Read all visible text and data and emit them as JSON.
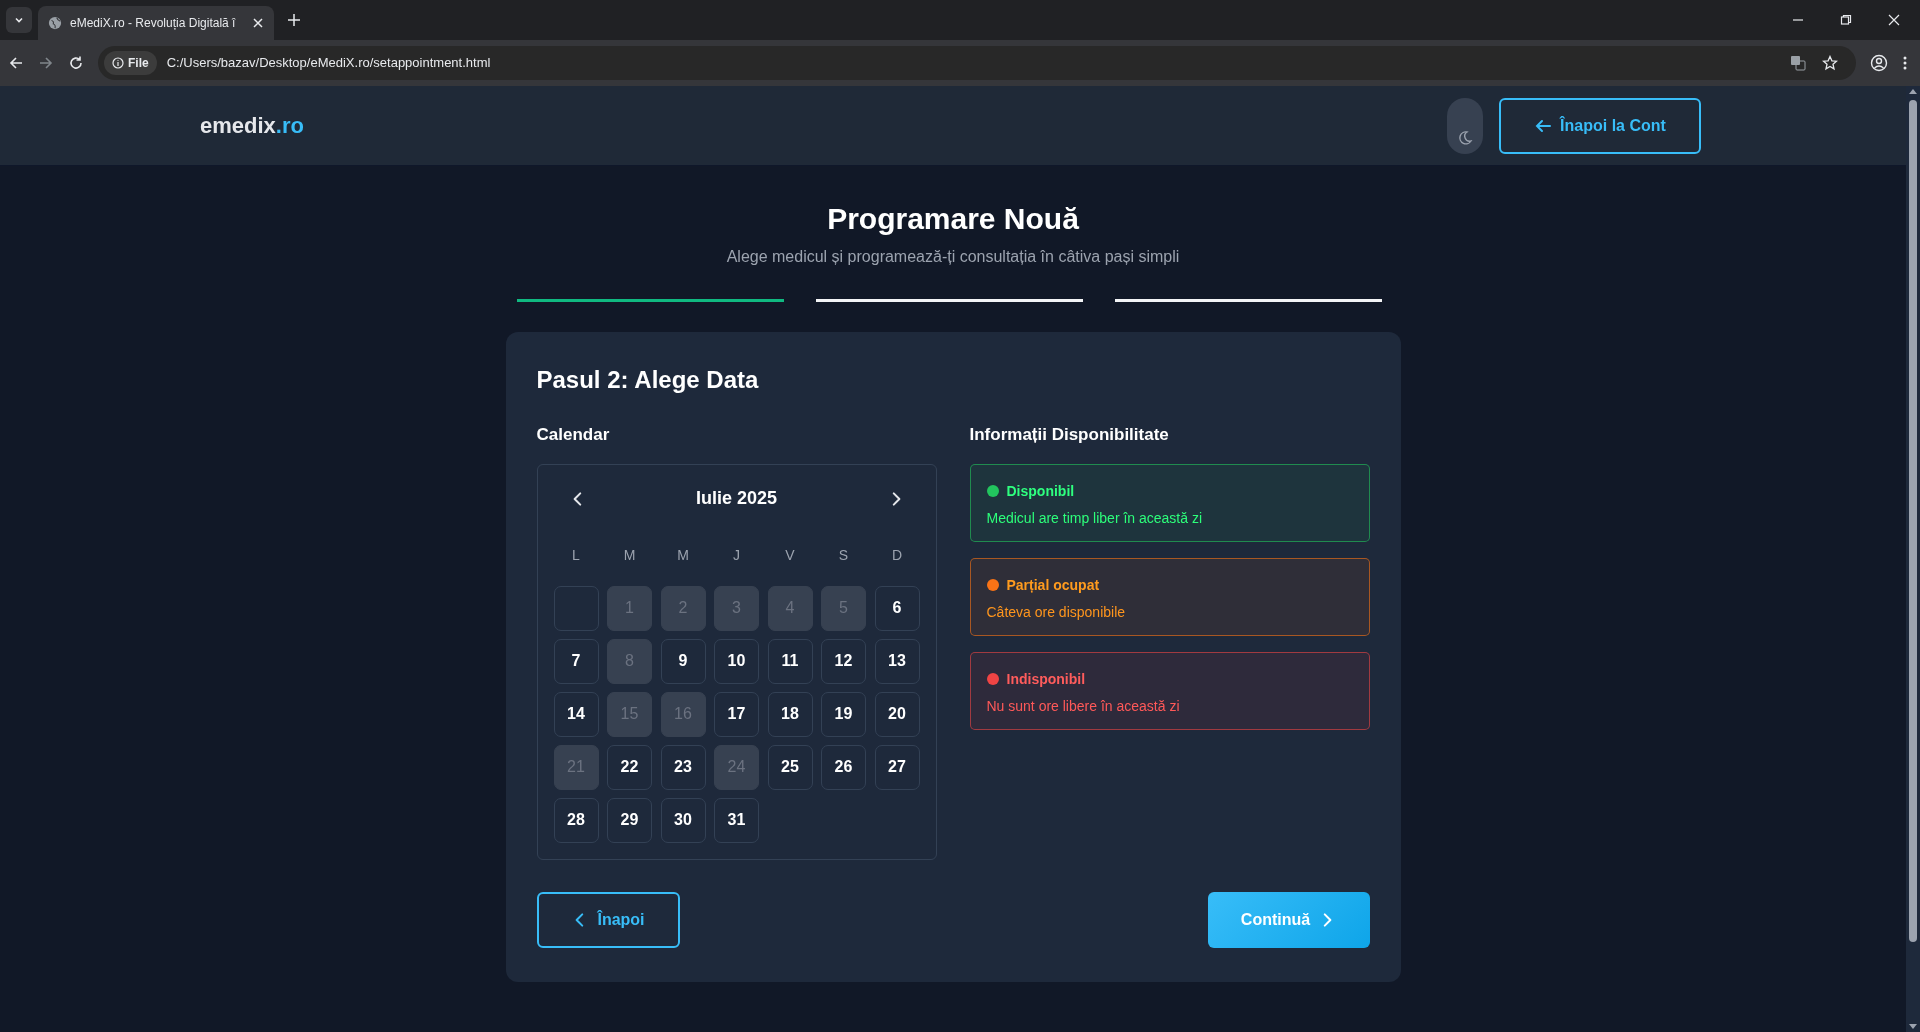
{
  "browser": {
    "tab_title": "eMediX.ro - Revoluția Digitală î",
    "address_badge": "File",
    "url": "C:/Users/bazav/Desktop/eMediX.ro/setappointment.html"
  },
  "header": {
    "logo_main": "emedix",
    "logo_accent": ".ro",
    "back_button": "Înapoi la Cont"
  },
  "page": {
    "title": "Programare Nouă",
    "subtitle": "Alege medicul și programează-ți consultația în câtiva pași simpli"
  },
  "steps": [
    {
      "completed": true
    },
    {
      "completed": false
    },
    {
      "completed": false
    }
  ],
  "step_card": {
    "title": "Pasul 2: Alege Data",
    "calendar_heading": "Calendar",
    "info_heading": "Informații Disponibilitate"
  },
  "calendar": {
    "month": "Iulie 2025",
    "weekdays": [
      "L",
      "M",
      "M",
      "J",
      "V",
      "S",
      "D"
    ],
    "days": [
      {
        "kind": "empty"
      },
      {
        "kind": "day",
        "label": "1",
        "disabled": true
      },
      {
        "kind": "day",
        "label": "2",
        "disabled": true
      },
      {
        "kind": "day",
        "label": "3",
        "disabled": true
      },
      {
        "kind": "day",
        "label": "4",
        "disabled": true
      },
      {
        "kind": "day",
        "label": "5",
        "disabled": true
      },
      {
        "kind": "day",
        "label": "6",
        "disabled": false
      },
      {
        "kind": "day",
        "label": "7",
        "disabled": false
      },
      {
        "kind": "day",
        "label": "8",
        "disabled": true
      },
      {
        "kind": "day",
        "label": "9",
        "disabled": false
      },
      {
        "kind": "day",
        "label": "10",
        "disabled": false
      },
      {
        "kind": "day",
        "label": "11",
        "disabled": false
      },
      {
        "kind": "day",
        "label": "12",
        "disabled": false
      },
      {
        "kind": "day",
        "label": "13",
        "disabled": false
      },
      {
        "kind": "day",
        "label": "14",
        "disabled": false
      },
      {
        "kind": "day",
        "label": "15",
        "disabled": true
      },
      {
        "kind": "day",
        "label": "16",
        "disabled": true
      },
      {
        "kind": "day",
        "label": "17",
        "disabled": false
      },
      {
        "kind": "day",
        "label": "18",
        "disabled": false
      },
      {
        "kind": "day",
        "label": "19",
        "disabled": false
      },
      {
        "kind": "day",
        "label": "20",
        "disabled": false
      },
      {
        "kind": "day",
        "label": "21",
        "disabled": true
      },
      {
        "kind": "day",
        "label": "22",
        "disabled": false
      },
      {
        "kind": "day",
        "label": "23",
        "disabled": false
      },
      {
        "kind": "day",
        "label": "24",
        "disabled": true
      },
      {
        "kind": "day",
        "label": "25",
        "disabled": false
      },
      {
        "kind": "day",
        "label": "26",
        "disabled": false
      },
      {
        "kind": "day",
        "label": "27",
        "disabled": false
      },
      {
        "kind": "day",
        "label": "28",
        "disabled": false
      },
      {
        "kind": "day",
        "label": "29",
        "disabled": false
      },
      {
        "kind": "day",
        "label": "30",
        "disabled": false
      },
      {
        "kind": "day",
        "label": "31",
        "disabled": false
      }
    ]
  },
  "legend": [
    {
      "title": "Disponibil",
      "text": "Medicul are timp liber în această zi",
      "color": "#22c55e"
    },
    {
      "title": "Parțial ocupat",
      "text": "Câteva ore disponibile",
      "color": "#f97316"
    },
    {
      "title": "Indisponibil",
      "text": "Nu sunt ore libere în această zi",
      "color": "#ef4444"
    }
  ],
  "buttons": {
    "back": "Înapoi",
    "continue": "Continuă"
  }
}
